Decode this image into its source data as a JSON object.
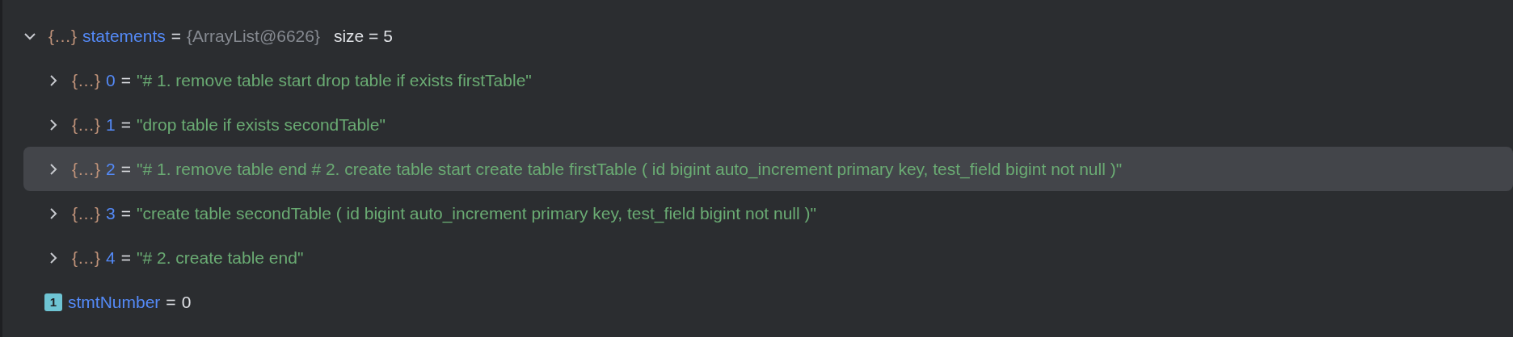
{
  "variables": [
    {
      "kind": "object",
      "glyph": "{…}",
      "name": "statements",
      "eq": "=",
      "type_label": "{ArrayList@6626}",
      "extra": "size = 5",
      "expanded": true,
      "selected": false,
      "children": [
        {
          "kind": "object",
          "glyph": "{…}",
          "name": "0",
          "eq": "=",
          "value": "\"# 1. remove table start drop table if exists firstTable\"",
          "expanded": false,
          "selected": false
        },
        {
          "kind": "object",
          "glyph": "{…}",
          "name": "1",
          "eq": "=",
          "value": "\"drop table if exists secondTable\"",
          "expanded": false,
          "selected": false
        },
        {
          "kind": "object",
          "glyph": "{…}",
          "name": "2",
          "eq": "=",
          "value": "\"# 1. remove table end # 2. create table start create table firstTable ( id bigint auto_increment primary key, test_field bigint not null )\"",
          "expanded": false,
          "selected": true
        },
        {
          "kind": "object",
          "glyph": "{…}",
          "name": "3",
          "eq": "=",
          "value": "\"create table secondTable ( id bigint auto_increment primary key, test_field bigint not null )\"",
          "expanded": false,
          "selected": false
        },
        {
          "kind": "object",
          "glyph": "{…}",
          "name": "4",
          "eq": "=",
          "value": "\"# 2. create table end\"",
          "expanded": false,
          "selected": false
        }
      ]
    },
    {
      "kind": "primitive",
      "glyph": "1",
      "name": "stmtNumber",
      "eq": "=",
      "number": "0",
      "selected": false
    }
  ]
}
